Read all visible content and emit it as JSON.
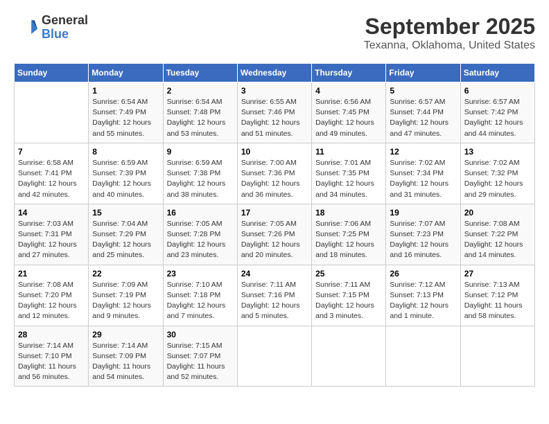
{
  "logo": {
    "line1": "General",
    "line2": "Blue"
  },
  "title": "September 2025",
  "subtitle": "Texanna, Oklahoma, United States",
  "days_of_week": [
    "Sunday",
    "Monday",
    "Tuesday",
    "Wednesday",
    "Thursday",
    "Friday",
    "Saturday"
  ],
  "weeks": [
    [
      {
        "num": "",
        "info": ""
      },
      {
        "num": "1",
        "info": "Sunrise: 6:54 AM\nSunset: 7:49 PM\nDaylight: 12 hours\nand 55 minutes."
      },
      {
        "num": "2",
        "info": "Sunrise: 6:54 AM\nSunset: 7:48 PM\nDaylight: 12 hours\nand 53 minutes."
      },
      {
        "num": "3",
        "info": "Sunrise: 6:55 AM\nSunset: 7:46 PM\nDaylight: 12 hours\nand 51 minutes."
      },
      {
        "num": "4",
        "info": "Sunrise: 6:56 AM\nSunset: 7:45 PM\nDaylight: 12 hours\nand 49 minutes."
      },
      {
        "num": "5",
        "info": "Sunrise: 6:57 AM\nSunset: 7:44 PM\nDaylight: 12 hours\nand 47 minutes."
      },
      {
        "num": "6",
        "info": "Sunrise: 6:57 AM\nSunset: 7:42 PM\nDaylight: 12 hours\nand 44 minutes."
      }
    ],
    [
      {
        "num": "7",
        "info": "Sunrise: 6:58 AM\nSunset: 7:41 PM\nDaylight: 12 hours\nand 42 minutes."
      },
      {
        "num": "8",
        "info": "Sunrise: 6:59 AM\nSunset: 7:39 PM\nDaylight: 12 hours\nand 40 minutes."
      },
      {
        "num": "9",
        "info": "Sunrise: 6:59 AM\nSunset: 7:38 PM\nDaylight: 12 hours\nand 38 minutes."
      },
      {
        "num": "10",
        "info": "Sunrise: 7:00 AM\nSunset: 7:36 PM\nDaylight: 12 hours\nand 36 minutes."
      },
      {
        "num": "11",
        "info": "Sunrise: 7:01 AM\nSunset: 7:35 PM\nDaylight: 12 hours\nand 34 minutes."
      },
      {
        "num": "12",
        "info": "Sunrise: 7:02 AM\nSunset: 7:34 PM\nDaylight: 12 hours\nand 31 minutes."
      },
      {
        "num": "13",
        "info": "Sunrise: 7:02 AM\nSunset: 7:32 PM\nDaylight: 12 hours\nand 29 minutes."
      }
    ],
    [
      {
        "num": "14",
        "info": "Sunrise: 7:03 AM\nSunset: 7:31 PM\nDaylight: 12 hours\nand 27 minutes."
      },
      {
        "num": "15",
        "info": "Sunrise: 7:04 AM\nSunset: 7:29 PM\nDaylight: 12 hours\nand 25 minutes."
      },
      {
        "num": "16",
        "info": "Sunrise: 7:05 AM\nSunset: 7:28 PM\nDaylight: 12 hours\nand 23 minutes."
      },
      {
        "num": "17",
        "info": "Sunrise: 7:05 AM\nSunset: 7:26 PM\nDaylight: 12 hours\nand 20 minutes."
      },
      {
        "num": "18",
        "info": "Sunrise: 7:06 AM\nSunset: 7:25 PM\nDaylight: 12 hours\nand 18 minutes."
      },
      {
        "num": "19",
        "info": "Sunrise: 7:07 AM\nSunset: 7:23 PM\nDaylight: 12 hours\nand 16 minutes."
      },
      {
        "num": "20",
        "info": "Sunrise: 7:08 AM\nSunset: 7:22 PM\nDaylight: 12 hours\nand 14 minutes."
      }
    ],
    [
      {
        "num": "21",
        "info": "Sunrise: 7:08 AM\nSunset: 7:20 PM\nDaylight: 12 hours\nand 12 minutes."
      },
      {
        "num": "22",
        "info": "Sunrise: 7:09 AM\nSunset: 7:19 PM\nDaylight: 12 hours\nand 9 minutes."
      },
      {
        "num": "23",
        "info": "Sunrise: 7:10 AM\nSunset: 7:18 PM\nDaylight: 12 hours\nand 7 minutes."
      },
      {
        "num": "24",
        "info": "Sunrise: 7:11 AM\nSunset: 7:16 PM\nDaylight: 12 hours\nand 5 minutes."
      },
      {
        "num": "25",
        "info": "Sunrise: 7:11 AM\nSunset: 7:15 PM\nDaylight: 12 hours\nand 3 minutes."
      },
      {
        "num": "26",
        "info": "Sunrise: 7:12 AM\nSunset: 7:13 PM\nDaylight: 12 hours\nand 1 minute."
      },
      {
        "num": "27",
        "info": "Sunrise: 7:13 AM\nSunset: 7:12 PM\nDaylight: 11 hours\nand 58 minutes."
      }
    ],
    [
      {
        "num": "28",
        "info": "Sunrise: 7:14 AM\nSunset: 7:10 PM\nDaylight: 11 hours\nand 56 minutes."
      },
      {
        "num": "29",
        "info": "Sunrise: 7:14 AM\nSunset: 7:09 PM\nDaylight: 11 hours\nand 54 minutes."
      },
      {
        "num": "30",
        "info": "Sunrise: 7:15 AM\nSunset: 7:07 PM\nDaylight: 11 hours\nand 52 minutes."
      },
      {
        "num": "",
        "info": ""
      },
      {
        "num": "",
        "info": ""
      },
      {
        "num": "",
        "info": ""
      },
      {
        "num": "",
        "info": ""
      }
    ]
  ]
}
